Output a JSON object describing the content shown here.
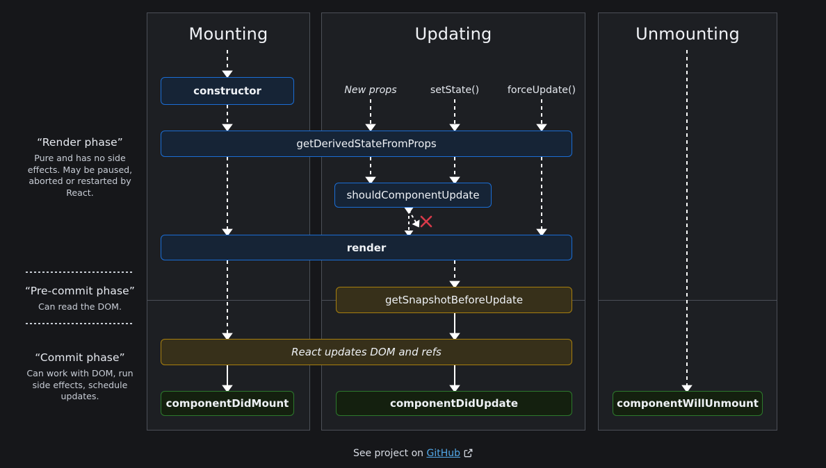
{
  "page": {
    "background": "#16171a",
    "footer_prefix": "See project on ",
    "footer_link": "GitHub",
    "footer_icon": "external-link-icon"
  },
  "phases": [
    {
      "id": "render",
      "title": "“Render phase”",
      "desc": "Pure and has no side effects. May be paused, aborted or restarted by React."
    },
    {
      "id": "pre-commit",
      "title": "“Pre-commit phase”",
      "desc": "Can read the DOM."
    },
    {
      "id": "commit",
      "title": "“Commit phase”",
      "desc": "Can work with DOM, run side effects, schedule updates."
    }
  ],
  "columns": [
    {
      "id": "mounting",
      "title": "Mounting"
    },
    {
      "id": "updating",
      "title": "Updating"
    },
    {
      "id": "unmounting",
      "title": "Unmounting"
    }
  ],
  "triggers": [
    {
      "id": "new-props",
      "label": "New props",
      "style": "italic"
    },
    {
      "id": "set-state",
      "label": "setState()",
      "style": "normal"
    },
    {
      "id": "force-update",
      "label": "forceUpdate()",
      "style": "normal"
    }
  ],
  "nodes": [
    {
      "id": "constructor",
      "label": "constructor",
      "color": "blue",
      "weight": "bold",
      "column": "mounting"
    },
    {
      "id": "get-derived-state-from-props",
      "label": "getDerivedStateFromProps",
      "color": "blue",
      "weight": "normal",
      "column": "mounting+updating"
    },
    {
      "id": "should-component-update",
      "label": "shouldComponentUpdate",
      "color": "blue",
      "weight": "normal",
      "column": "updating"
    },
    {
      "id": "render",
      "label": "render",
      "color": "blue",
      "weight": "bold",
      "column": "mounting+updating"
    },
    {
      "id": "get-snapshot-before-update",
      "label": "getSnapshotBeforeUpdate",
      "color": "amber",
      "weight": "normal",
      "column": "updating"
    },
    {
      "id": "react-updates-dom-and-refs",
      "label": "React updates DOM and refs",
      "color": "amber",
      "weight": "italic",
      "column": "mounting+updating"
    },
    {
      "id": "component-did-mount",
      "label": "componentDidMount",
      "color": "green",
      "weight": "bold",
      "column": "mounting"
    },
    {
      "id": "component-did-update",
      "label": "componentDidUpdate",
      "color": "green",
      "weight": "bold",
      "column": "updating"
    },
    {
      "id": "component-will-unmount",
      "label": "componentWillUnmount",
      "color": "green",
      "weight": "bold",
      "column": "unmounting"
    }
  ],
  "colors": {
    "blue_border": "#1b6ed6",
    "blue_fill": "#162436",
    "amber_border": "#a8800f",
    "amber_fill": "#37301a",
    "green_border": "#2d7a2d",
    "green_fill": "#14200f",
    "panel_fill": "#1d1f23",
    "panel_border": "#4c5058",
    "arrow": "#ffffff",
    "cross": "#d93a4a",
    "link": "#52a8e8"
  },
  "annotations": [
    {
      "id": "skip-render-cross",
      "icon": "red-x-icon",
      "meaning": "shouldComponentUpdate may skip render"
    }
  ]
}
